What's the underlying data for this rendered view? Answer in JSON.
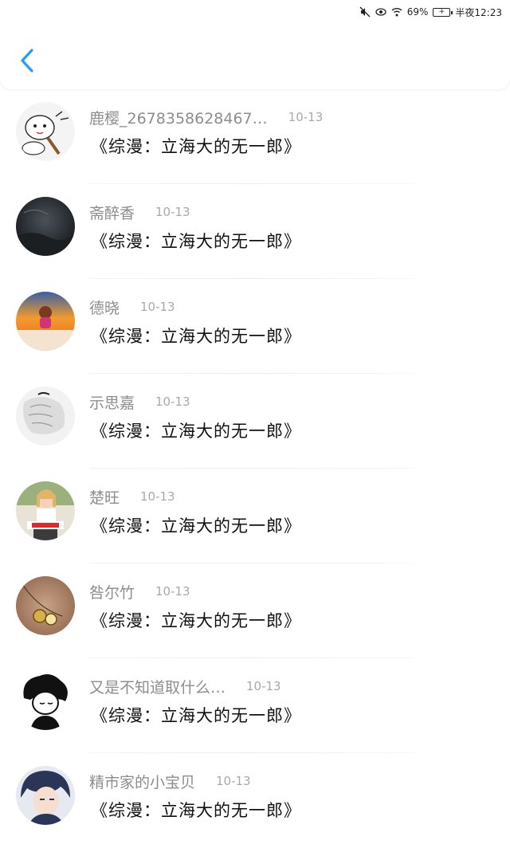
{
  "status_bar": {
    "battery": "69%",
    "time": "半夜12:23",
    "icons": [
      "mute-icon",
      "eye-icon",
      "wifi-icon",
      "battery-icon"
    ]
  },
  "header": {
    "back_icon": "chevron-left-icon",
    "accent_color": "#2b9af3"
  },
  "items": [
    {
      "name": "鹿樱_2678358628467…",
      "date": "10-13",
      "message": "《综漫：立海大的无一郎》",
      "avatar_icon": "avatar-cartoon-cat"
    },
    {
      "name": "斋醉香",
      "date": "10-13",
      "message": "《综漫：立海大的无一郎》",
      "avatar_icon": "avatar-dark-storm"
    },
    {
      "name": "德晓",
      "date": "10-13",
      "message": "《综漫：立海大的无一郎》",
      "avatar_icon": "avatar-monkey-sunset"
    },
    {
      "name": "示思嘉",
      "date": "10-13",
      "message": "《综漫：立海大的无一郎》",
      "avatar_icon": "avatar-white-hair"
    },
    {
      "name": "楚旺",
      "date": "10-13",
      "message": "《综漫：立海大的无一郎》",
      "avatar_icon": "avatar-girl-photo"
    },
    {
      "name": "咎尔竹",
      "date": "10-13",
      "message": "《综漫：立海大的无一郎》",
      "avatar_icon": "avatar-necklace"
    },
    {
      "name": "又是不知道取什么…",
      "date": "10-13",
      "message": "《综漫：立海大的无一郎》",
      "avatar_icon": "avatar-bw-sketch"
    },
    {
      "name": "精市家的小宝贝",
      "date": "10-13",
      "message": "《综漫：立海大的无一郎》",
      "avatar_icon": "avatar-anime-boy"
    }
  ]
}
